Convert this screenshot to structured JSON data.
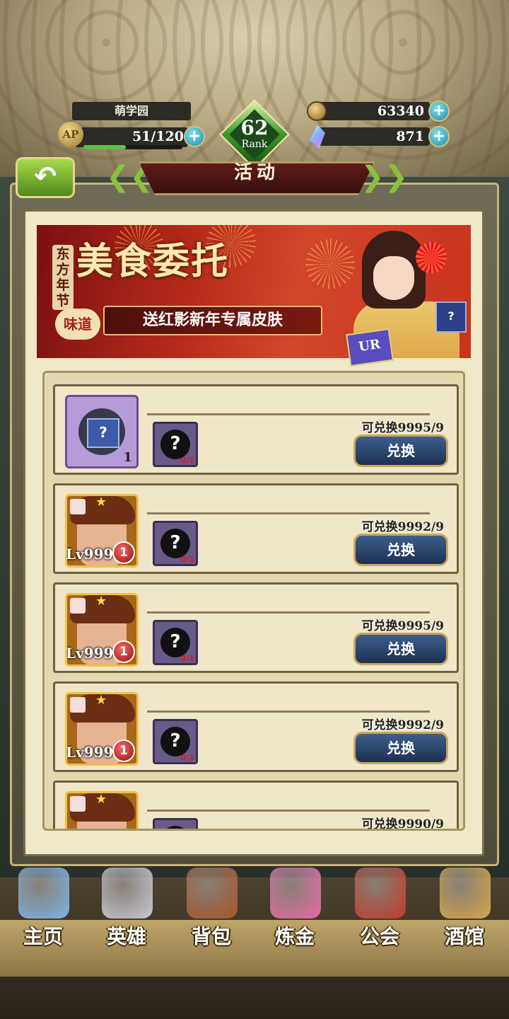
{
  "header": {
    "school_name": "萌学园",
    "ap_label": "AP",
    "ap_value": "51/120",
    "ap_fraction": 0.425,
    "rank_number": "62",
    "rank_label": "Rank",
    "gold": "63340",
    "crystals": "871",
    "plus": "+"
  },
  "title_bar": {
    "back_symbol": "↶",
    "title": "活动",
    "left_chevron": "❮❮",
    "right_chevron": "❯❯"
  },
  "banner": {
    "vertical_text": "东方年节",
    "badge_text": "味道",
    "main_title": "美食委托",
    "subtitle": "送红影新年专属皮肤",
    "card_text": "UR",
    "box_text": "?"
  },
  "exchange_items": [
    {
      "icon": "mystery-cube",
      "quantity": "1",
      "req_count": "0/1",
      "available": "可兑换9995/9",
      "button": "兑换"
    },
    {
      "icon": "hero-shard",
      "level": "Lv999",
      "badge": "1",
      "req_count": "0/1",
      "available": "可兑换9992/9",
      "button": "兑换"
    },
    {
      "icon": "hero-shard",
      "level": "Lv999",
      "badge": "1",
      "req_count": "0/1",
      "available": "可兑换9995/9",
      "button": "兑换"
    },
    {
      "icon": "hero-shard",
      "level": "Lv999",
      "badge": "1",
      "req_count": "0/1",
      "available": "可兑换9992/9",
      "button": "兑换"
    },
    {
      "icon": "hero-shard",
      "level": "",
      "badge": "",
      "req_count": "",
      "available": "可兑换9990/9",
      "button": ""
    }
  ],
  "bottom_nav": [
    {
      "label": "主页",
      "icon": "castle-icon",
      "color": "#7fb4e8"
    },
    {
      "label": "英雄",
      "icon": "helmet-icon",
      "color": "#c9c9d6"
    },
    {
      "label": "背包",
      "icon": "backpack-icon",
      "color": "#a8552a"
    },
    {
      "label": "炼金",
      "icon": "potion-icon",
      "color": "#e86aa8"
    },
    {
      "label": "公会",
      "icon": "guild-shield-icon",
      "color": "#c23a2a"
    },
    {
      "label": "酒馆",
      "icon": "beer-mug-icon",
      "color": "#d9a64a"
    }
  ],
  "colors": {
    "accent_green": "#5ec04a",
    "button_blue": "#2a4670",
    "banner_red": "#c8331e"
  }
}
